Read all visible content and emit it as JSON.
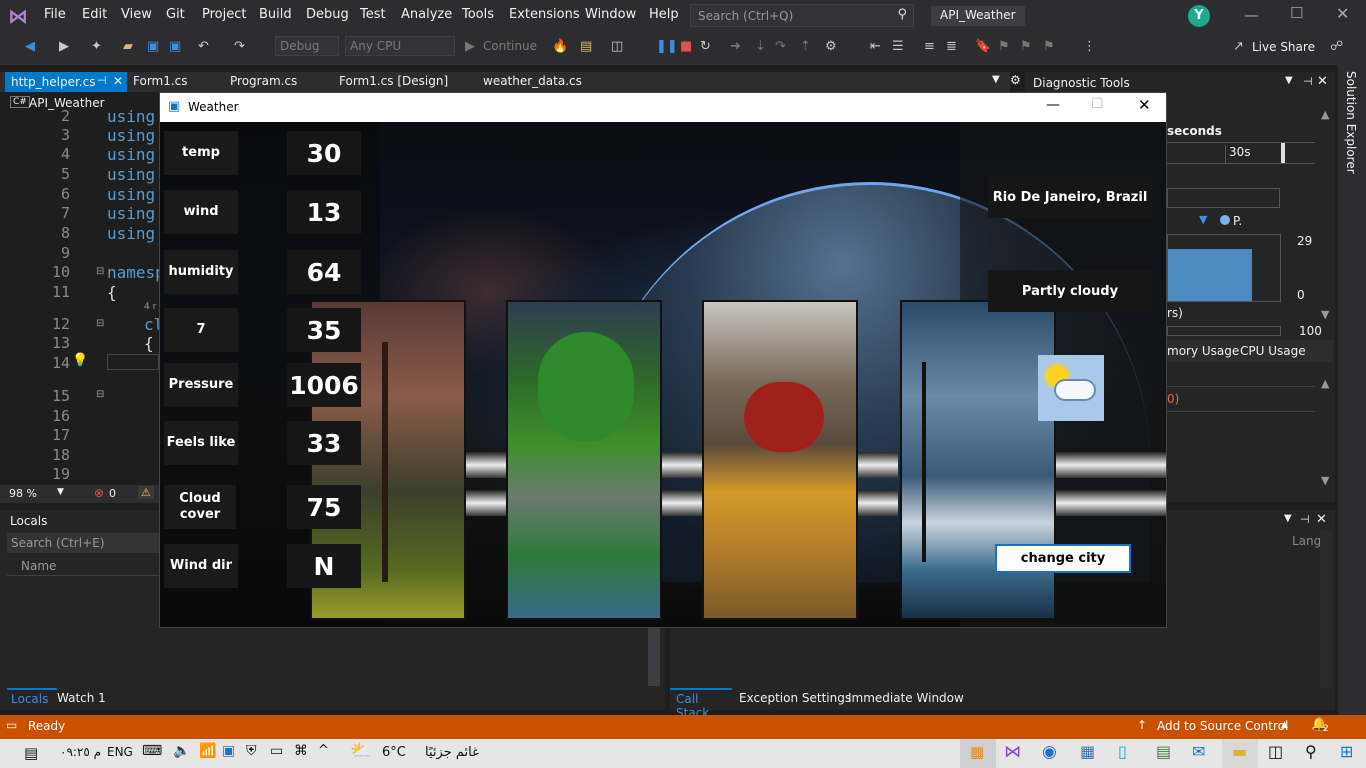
{
  "menu": [
    "File",
    "Edit",
    "View",
    "Git",
    "Project",
    "Build",
    "Debug",
    "Test",
    "Analyze",
    "Tools",
    "Extensions",
    "Window",
    "Help"
  ],
  "search_placeholder": "Search (Ctrl+Q)",
  "solution_name": "API_Weather",
  "user_initial": "Y",
  "toolbar": {
    "config": "Debug",
    "platform": "Any CPU",
    "continue": "Continue",
    "live_share": "Live Share"
  },
  "tabs": [
    "http_helper.cs",
    "Form1.cs",
    "Program.cs",
    "Form1.cs [Design]",
    "weather_data.cs"
  ],
  "nav_project": "API_Weather",
  "editor": {
    "lines": [
      "2",
      "3",
      "4",
      "5",
      "6",
      "7",
      "8",
      "9",
      "10",
      "11",
      "",
      "12",
      "13",
      "14",
      "15",
      "16",
      "17",
      "18",
      "19"
    ],
    "code": [
      "using",
      "using",
      "using",
      "using",
      "using",
      "using",
      "using",
      "",
      "namesp",
      "{",
      "",
      "cl",
      "{",
      "",
      "",
      "",
      "",
      "",
      ""
    ],
    "refs": "4 r",
    "zoom": "98 %",
    "errors": "0"
  },
  "diag": {
    "title": "Diagnostic Tools",
    "seconds": "seconds",
    "time_label": "30s",
    "legend": "P.",
    "y_max": "29",
    "y_min": "0",
    "partial": "rs)",
    "hundred": "100",
    "tab_memory": "mory Usage",
    "tab_cpu": "CPU Usage",
    "row": "0)"
  },
  "solution_explorer": "Solution Explorer",
  "locals": {
    "title": "Locals",
    "search": "Search (Ctrl+E)",
    "col_name": "Name",
    "tab1": "Locals",
    "tab2": "Watch 1"
  },
  "bottom_right": {
    "col": "Lang",
    "tab1": "Call Stack",
    "tab2": "Exception Settings",
    "tab3": "Immediate Window"
  },
  "status": {
    "ready": "Ready",
    "source_control": "Add to Source Control",
    "notifications": "2"
  },
  "taskbar": {
    "time": "م ٠٩:٢٥",
    "lang": "ENG",
    "temp": "6°C",
    "weather": "غائم جزئيًا"
  },
  "weather_app": {
    "title": "Weather",
    "rows": [
      {
        "label": "temp",
        "value": "30"
      },
      {
        "label": "wind",
        "value": "13"
      },
      {
        "label": "humidity",
        "value": "64"
      },
      {
        "label": "7",
        "value": "35"
      },
      {
        "label": "Pressure",
        "value": "1006"
      },
      {
        "label": "Feels like",
        "value": "33"
      },
      {
        "label": "Cloud cover",
        "value": "75"
      },
      {
        "label": "Wind dir",
        "value": "N"
      }
    ],
    "city": "Rio De Janeiro, Brazil",
    "condition": "Partly cloudy",
    "change_city": "change city"
  },
  "colors": {
    "accent": "#007acc",
    "status": "#ca5100",
    "bg": "#1e1e1e",
    "keyword": "#569cd6"
  }
}
